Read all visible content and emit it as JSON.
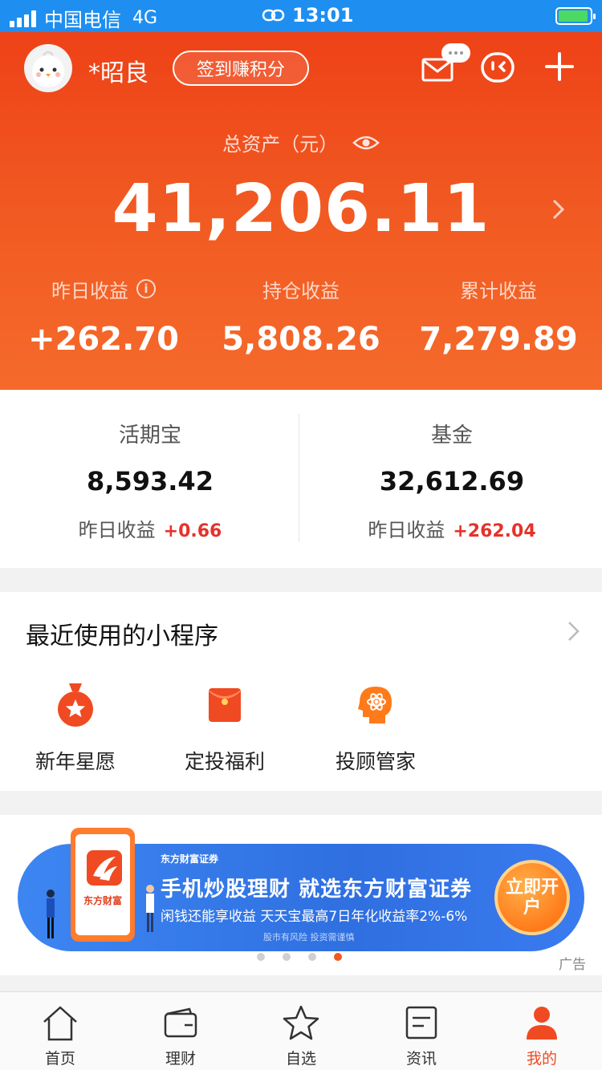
{
  "status_bar": {
    "carrier": "中国电信",
    "network": "4G",
    "time": "13:01"
  },
  "header": {
    "username": "*昭良",
    "signin_label": "签到赚积分",
    "total_assets_label": "总资产（元）",
    "total_assets": "41,206.11",
    "stats": [
      {
        "label": "昨日收益",
        "value": "+262.70"
      },
      {
        "label": "持仓收益",
        "value": "5,808.26"
      },
      {
        "label": "累计收益",
        "value": "7,279.89"
      }
    ],
    "info_glyph": "i"
  },
  "accounts": [
    {
      "name": "活期宝",
      "amount": "8,593.42",
      "yesterday_label": "昨日收益",
      "yesterday_value": "+0.66"
    },
    {
      "name": "基金",
      "amount": "32,612.69",
      "yesterday_label": "昨日收益",
      "yesterday_value": "+262.04"
    }
  ],
  "mini_programs": {
    "title": "最近使用的小程序",
    "items": [
      {
        "label": "新年星愿",
        "icon": "star-bag-icon"
      },
      {
        "label": "定投福利",
        "icon": "red-envelope-icon"
      },
      {
        "label": "投顾管家",
        "icon": "brain-atom-icon"
      }
    ]
  },
  "banner": {
    "app_name": "东方财富",
    "brand": "东方财富证券",
    "headline": "手机炒股理财 就选东方财富证券",
    "sub": "闲钱还能享收益 天天宝最高7日年化收益率2%-6%",
    "risk": "股市有风险 投资需谨慎",
    "cta": "立即开户",
    "ad_label": "广告",
    "active_slide": 4,
    "slide_count": 4
  },
  "tabbar": [
    {
      "label": "首页",
      "icon": "home-icon",
      "active": false
    },
    {
      "label": "理财",
      "icon": "wallet-icon",
      "active": false
    },
    {
      "label": "自选",
      "icon": "star-icon",
      "active": false
    },
    {
      "label": "资讯",
      "icon": "news-icon",
      "active": false
    },
    {
      "label": "我的",
      "icon": "user-icon",
      "active": true
    }
  ],
  "colors": {
    "brand_red": "#f04a22",
    "gain_red": "#e5322a",
    "status_bar_blue": "#1e8ff0"
  }
}
